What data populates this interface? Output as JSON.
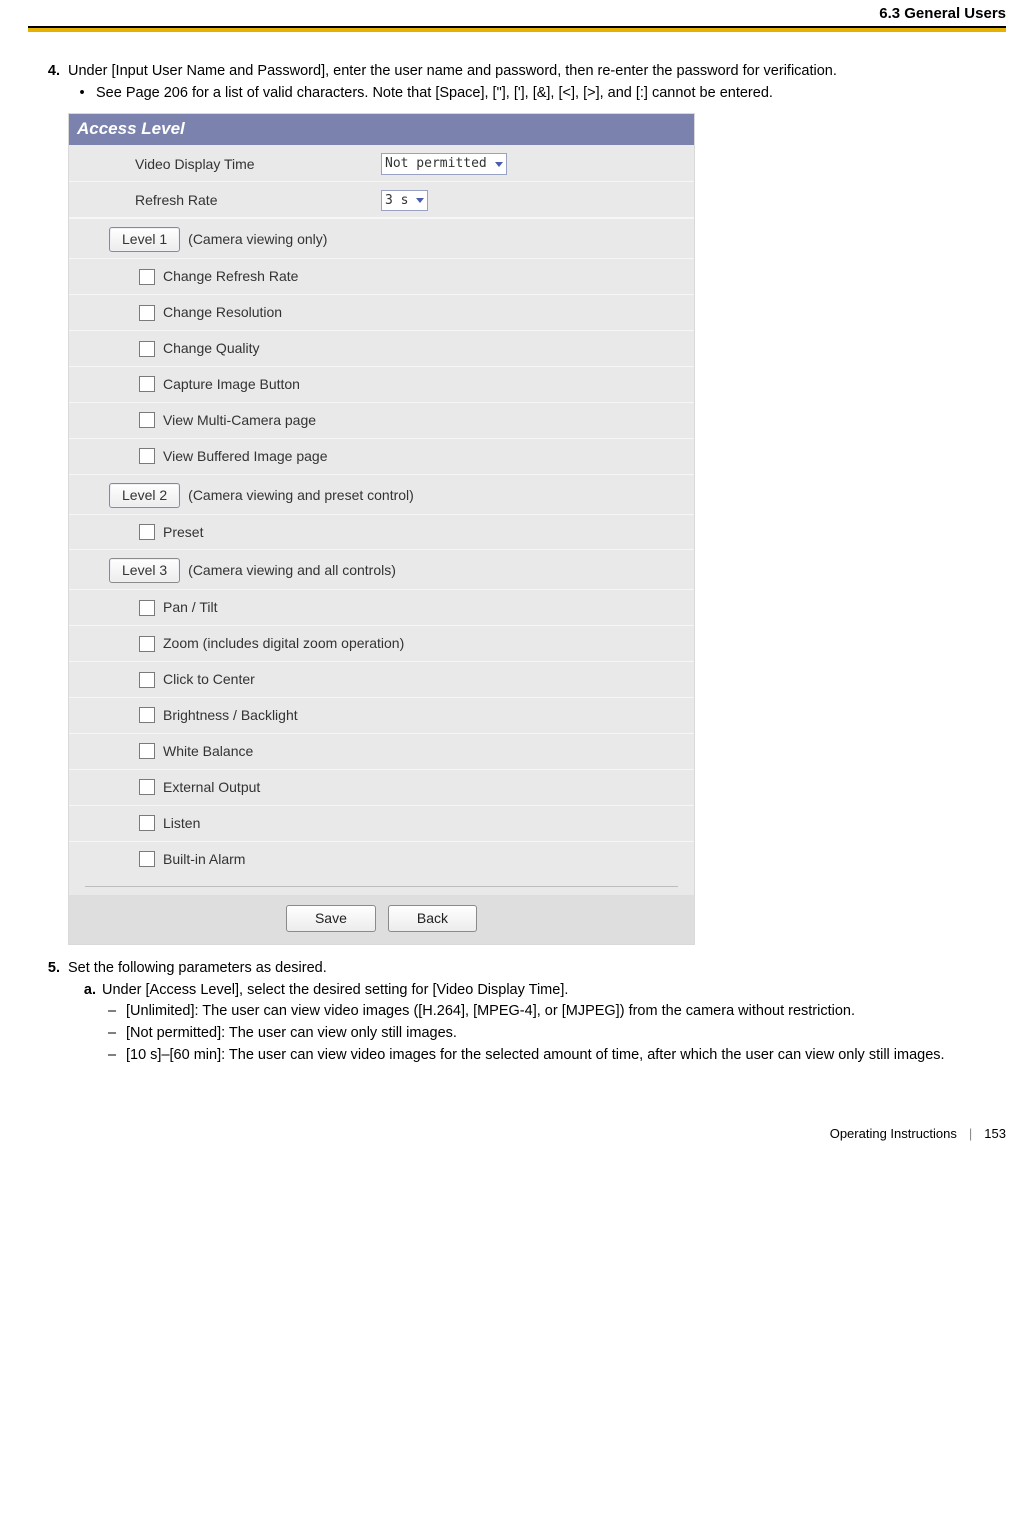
{
  "header": {
    "section": "6.3 General Users"
  },
  "step4": {
    "num": "4.",
    "text": "Under [Input User Name and Password], enter the user name and password, then re-enter the password for verification.",
    "bullet": "See Page 206 for a list of valid characters. Note that [Space], [\"], ['], [&], [<], [>], and [:] cannot be entered."
  },
  "panel": {
    "title": "Access Level",
    "videoDisplayTime": {
      "label": "Video Display Time",
      "value": "Not permitted"
    },
    "refreshRate": {
      "label": "Refresh Rate",
      "value": "3 s"
    },
    "level1": {
      "btn": "Level 1",
      "note": "(Camera viewing only)"
    },
    "checks1": [
      "Change Refresh Rate",
      "Change Resolution",
      "Change Quality",
      "Capture Image Button",
      "View Multi-Camera page",
      "View Buffered Image page"
    ],
    "level2": {
      "btn": "Level 2",
      "note": "(Camera viewing and preset control)"
    },
    "checks2": [
      "Preset"
    ],
    "level3": {
      "btn": "Level 3",
      "note": "(Camera viewing and all controls)"
    },
    "checks3": [
      "Pan / Tilt",
      "Zoom (includes digital zoom operation)",
      "Click to Center",
      "Brightness / Backlight",
      "White Balance",
      "External Output",
      "Listen",
      "Built-in Alarm"
    ],
    "saveBtn": "Save",
    "backBtn": "Back"
  },
  "step5": {
    "num": "5.",
    "text": "Set the following parameters as desired.",
    "a": {
      "letter": "a.",
      "text": "Under [Access Level], select the desired setting for [Video Display Time].",
      "dashes": [
        "[Unlimited]: The user can view video images ([H.264], [MPEG-4], or [MJPEG]) from the camera without restriction.",
        "[Not permitted]: The user can view only still images.",
        "[10 s]–[60 min]: The user can view video images for the selected amount of time, after which the user can view only still images."
      ]
    }
  },
  "footer": {
    "doc": "Operating Instructions",
    "page": "153"
  }
}
